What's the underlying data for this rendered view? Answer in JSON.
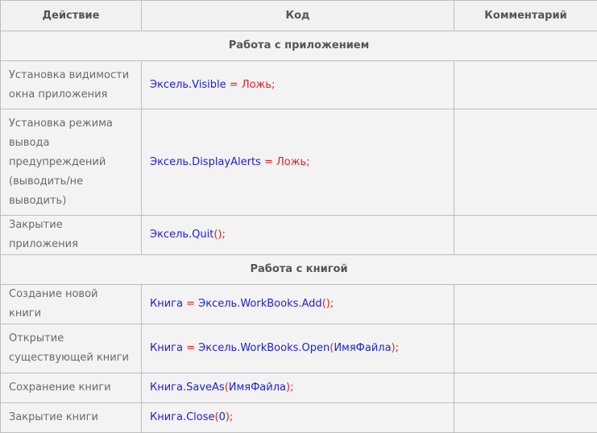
{
  "table": {
    "headers": {
      "action": "Действие",
      "code": "Код",
      "comment": "Комментарий"
    },
    "sections": [
      {
        "title": "Работа с приложением",
        "rows": [
          {
            "action": "Установка видимости окна приложения",
            "code": [
              {
                "t": "Эксель.Visible",
                "k": "id"
              },
              {
                "t": " = ",
                "k": "op"
              },
              {
                "t": "Ложь",
                "k": "kw"
              },
              {
                "t": ";",
                "k": "op"
              }
            ],
            "comment": ""
          },
          {
            "action": "Установка режима вывода предупреждений (выводить/не выводить)",
            "code": [
              {
                "t": "Эксель.DisplayAlerts",
                "k": "id"
              },
              {
                "t": " = ",
                "k": "op"
              },
              {
                "t": "Ложь",
                "k": "kw"
              },
              {
                "t": ";",
                "k": "op"
              }
            ],
            "comment": ""
          },
          {
            "action": "Закрытие приложения",
            "code": [
              {
                "t": "Эксель.Quit",
                "k": "id"
              },
              {
                "t": "();",
                "k": "op"
              }
            ],
            "comment": ""
          }
        ]
      },
      {
        "title": "Работа с книгой",
        "rows": [
          {
            "action": "Создание новой книги",
            "code": [
              {
                "t": "Книга",
                "k": "id"
              },
              {
                "t": " = ",
                "k": "op"
              },
              {
                "t": "Эксель.WorkBooks.Add",
                "k": "id"
              },
              {
                "t": "();",
                "k": "op"
              }
            ],
            "comment": ""
          },
          {
            "action": "Открытие существующей книги",
            "code": [
              {
                "t": "Книга",
                "k": "id"
              },
              {
                "t": " = ",
                "k": "op"
              },
              {
                "t": "Эксель.WorkBooks.Open",
                "k": "id"
              },
              {
                "t": "(",
                "k": "op"
              },
              {
                "t": "ИмяФайла",
                "k": "id"
              },
              {
                "t": ");",
                "k": "op"
              }
            ],
            "comment": ""
          },
          {
            "action": "Сохранение книги",
            "code": [
              {
                "t": "Книга.SaveAs",
                "k": "id"
              },
              {
                "t": "(",
                "k": "op"
              },
              {
                "t": "ИмяФайла",
                "k": "id"
              },
              {
                "t": ");",
                "k": "op"
              }
            ],
            "comment": ""
          },
          {
            "action": "Закрытие книги",
            "code": [
              {
                "t": "Книга.Close",
                "k": "id"
              },
              {
                "t": "(",
                "k": "op"
              },
              {
                "t": "0",
                "k": "id"
              },
              {
                "t": ");",
                "k": "op"
              }
            ],
            "comment": ""
          }
        ]
      }
    ]
  }
}
